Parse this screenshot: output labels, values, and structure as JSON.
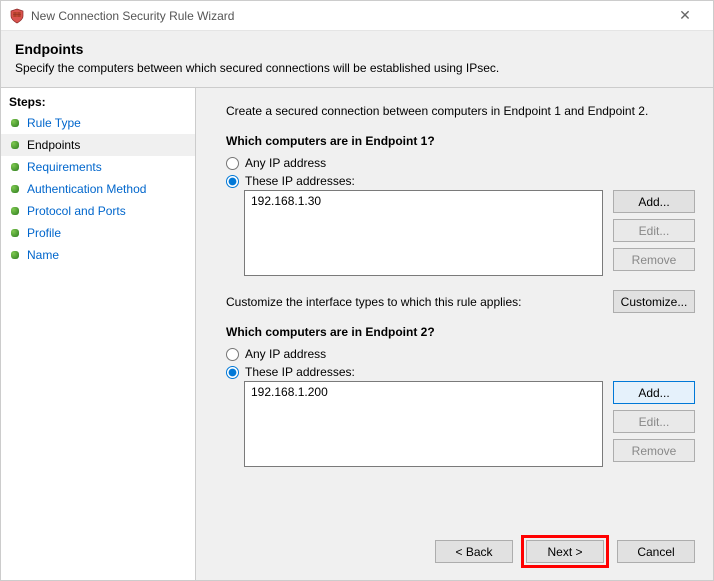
{
  "window": {
    "title": "New Connection Security Rule Wizard",
    "close_glyph": "✕"
  },
  "header": {
    "heading": "Endpoints",
    "subtext": "Specify the computers between which secured connections will be established using IPsec."
  },
  "sidebar": {
    "heading": "Steps:",
    "items": [
      {
        "label": "Rule Type"
      },
      {
        "label": "Endpoints"
      },
      {
        "label": "Requirements"
      },
      {
        "label": "Authentication Method"
      },
      {
        "label": "Protocol and Ports"
      },
      {
        "label": "Profile"
      },
      {
        "label": "Name"
      }
    ],
    "active_index": 1
  },
  "main": {
    "intro": "Create a secured connection between computers in Endpoint 1 and Endpoint 2.",
    "endpoint1": {
      "question": "Which computers are in Endpoint 1?",
      "any_label": "Any IP address",
      "these_label": "These IP addresses:",
      "selected": "these",
      "list": [
        "192.168.1.30"
      ],
      "buttons": {
        "add": "Add...",
        "edit": "Edit...",
        "remove": "Remove"
      }
    },
    "customize_row": {
      "text": "Customize the interface types to which this rule applies:",
      "button": "Customize..."
    },
    "endpoint2": {
      "question": "Which computers are in Endpoint 2?",
      "any_label": "Any IP address",
      "these_label": "These IP addresses:",
      "selected": "these",
      "list": [
        "192.168.1.200"
      ],
      "buttons": {
        "add": "Add...",
        "edit": "Edit...",
        "remove": "Remove"
      }
    }
  },
  "footer": {
    "back": "< Back",
    "next": "Next >",
    "cancel": "Cancel"
  }
}
